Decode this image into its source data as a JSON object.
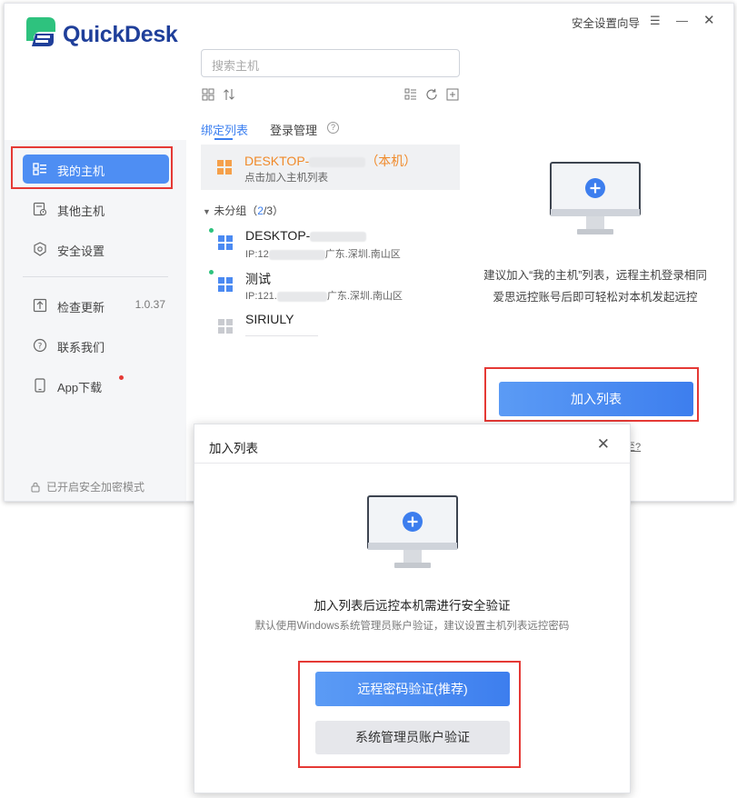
{
  "app": {
    "brand": "QuickDesk",
    "title_bar": {
      "security_wizard": "安全设置向导",
      "menu_icon": "menu-icon",
      "minimize_icon": "minimize-icon",
      "close_icon": "close-icon"
    }
  },
  "sidebar": {
    "items": [
      {
        "label": "我的主机",
        "icon": "host-list-icon",
        "active": true
      },
      {
        "label": "其他主机",
        "icon": "other-host-icon"
      },
      {
        "label": "安全设置",
        "icon": "shield-icon"
      },
      {
        "label": "检查更新",
        "icon": "upload-icon",
        "version": "1.0.37"
      },
      {
        "label": "联系我们",
        "icon": "help-icon"
      },
      {
        "label": "App下载",
        "icon": "phone-icon",
        "badge": "red-dot"
      }
    ],
    "security_mode": "已开启安全加密模式"
  },
  "middle": {
    "search_placeholder": "搜索主机",
    "tabs": [
      {
        "label": "绑定列表",
        "active": true
      },
      {
        "label": "登录管理"
      }
    ],
    "help_glyph": "?",
    "local_host": {
      "name_prefix": "DESKTOP-",
      "name_suffix": "（本机）",
      "subtitle": "点击加入主机列表"
    },
    "group": {
      "label": "未分组",
      "count_open": "（",
      "count": "2",
      "count_sep": "/",
      "total": "3",
      "count_close": "）"
    },
    "hosts": [
      {
        "name": "DESKTOP-",
        "ip_prefix": "IP:12",
        "location": "广东.深圳.南山区",
        "online": true
      },
      {
        "name": "测试",
        "ip_prefix": "IP:121.",
        "location": "广东.深圳.南山区",
        "online": true
      },
      {
        "name": "SIRIULY",
        "online": false
      }
    ]
  },
  "right": {
    "desc_line1": "建议加入“我的主机”列表，远程主机登录相同",
    "desc_line2": "爱思远控账号后即可轻松对本机发起远控",
    "join_button": "加入列表",
    "partial_link": "至?"
  },
  "dialog": {
    "title": "加入列表",
    "close_glyph": "✕",
    "heading": "加入列表后远控本机需进行安全验证",
    "subtext": "默认使用Windows系统管理员账户验证，建议设置主机列表远控密码",
    "primary_button": "远程密码验证(推荐)",
    "secondary_button": "系统管理员账户验证"
  },
  "colors": {
    "accent": "#4b8af2",
    "brand_dark": "#1f3f9a",
    "brand_green": "#2ec27e",
    "local_host_orange": "#f08a2a",
    "highlight_red": "#e53935"
  }
}
